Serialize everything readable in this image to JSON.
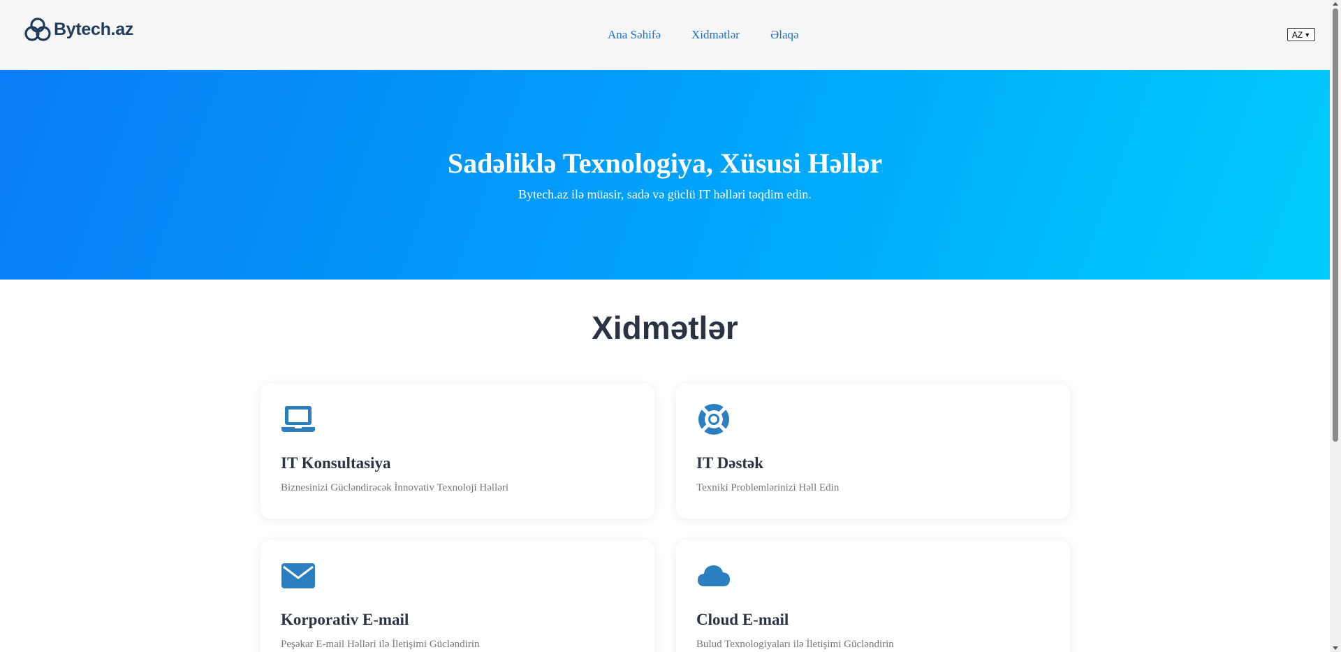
{
  "brand": {
    "name": "Bytech.az"
  },
  "nav": {
    "items": [
      "Ana Səhifə",
      "Xidmətlər",
      "Əlaqə"
    ]
  },
  "lang": {
    "selected": "AZ"
  },
  "hero": {
    "title": "Sadəliklə Texnologiya, Xüsusi Həllər",
    "subtitle": "Bytech.az ilə müasir, sadə və güclü IT həlləri təqdim edin."
  },
  "services": {
    "title": "Xidmətlər",
    "cards": [
      {
        "icon": "laptop-icon",
        "title": "IT Konsultasiya",
        "desc": "Biznesinizi Gücləndirəcək İnnovativ Texnoloji Həlləri"
      },
      {
        "icon": "lifebuoy-icon",
        "title": "IT Dəstək",
        "desc": "Texniki Problemlərinizi Həll Edin"
      },
      {
        "icon": "envelope-icon",
        "title": "Korporativ E-mail",
        "desc": "Peşəkar E-mail Həlləri ilə İletişimi Gücləndirin"
      },
      {
        "icon": "cloud-icon",
        "title": "Cloud E-mail",
        "desc": "Bulud Texnologiyaları ilə İletişimi Gücləndirin"
      }
    ]
  },
  "colors": {
    "primary": "#1f6fd1",
    "icon": "#2a7fc1",
    "heading": "#2b3442",
    "hero_start": "#0a7cf5",
    "hero_end": "#00cdfb"
  }
}
